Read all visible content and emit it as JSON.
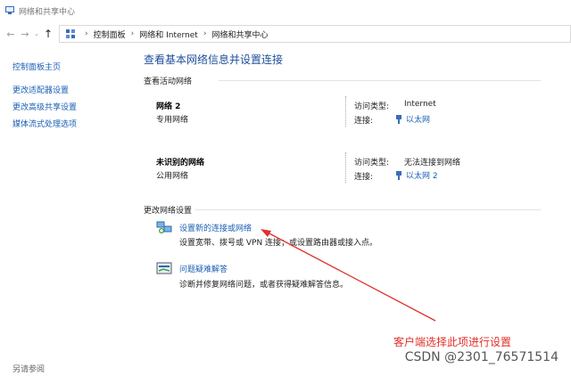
{
  "window": {
    "title": "网络和共享中心"
  },
  "addressbar": {
    "crumbs": [
      "控制面板",
      "网络和 Internet",
      "网络和共享中心"
    ]
  },
  "sidebar": {
    "items": [
      {
        "label": "控制面板主页"
      },
      {
        "label": "更改适配器设置"
      },
      {
        "label": "更改高级共享设置"
      },
      {
        "label": "媒体流式处理选项"
      }
    ],
    "see_also": "另请参阅"
  },
  "main": {
    "title": "查看基本网络信息并设置连接",
    "active_section": "查看活动网络",
    "networks": [
      {
        "name": "网络 2",
        "type": "专用网络",
        "access_label": "访问类型:",
        "access_value": "Internet",
        "conn_label": "连接:",
        "conn_value": "以太网"
      },
      {
        "name": "未识别的网络",
        "type": "公用网络",
        "access_label": "访问类型:",
        "access_value": "无法连接到网络",
        "conn_label": "连接:",
        "conn_value": "以太网 2"
      }
    ],
    "change_section": "更改网络设置",
    "tasks": [
      {
        "link": "设置新的连接或网络",
        "desc": "设置宽带、拨号或 VPN 连接；或设置路由器或接入点。"
      },
      {
        "link": "问题疑难解答",
        "desc": "诊断并修复网络问题，或者获得疑难解答信息。"
      }
    ]
  },
  "annotation": {
    "text": "客户端选择此项进行设置",
    "color": "#e0312a"
  },
  "watermark": "CSDN @2301_76571514"
}
